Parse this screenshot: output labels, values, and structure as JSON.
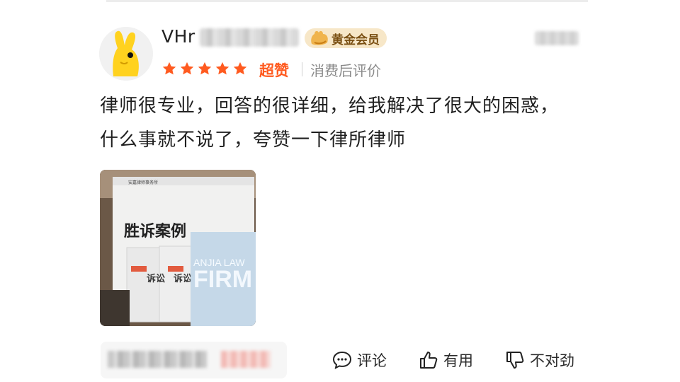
{
  "review": {
    "username": "VHr",
    "member_badge": "黄金会员",
    "rating_stars": 5,
    "rating_label": "超赞",
    "rating_note": "消费后评价",
    "content": "律师很专业，回答的很详细，给我解决了很大的困惑，什么事就不说了，夸赞一下律所律师",
    "photo": {
      "headline": "胜诉案例",
      "badge_text": "ANJIA LAW",
      "badge_text_2": "FIRM",
      "book_label": "诉讼"
    }
  },
  "actions": {
    "comment_label": "评论",
    "useful_label": "有用",
    "bad_label": "不对劲"
  },
  "colors": {
    "star": "#ff5a1f",
    "badge_bg": "#f7e7c8",
    "badge_text": "#7a4f12"
  },
  "icons": {
    "avatar": "rabbit-glove-avatar",
    "member": "gold-vip-icon",
    "comment": "comment-bubble-icon",
    "useful": "thumbs-up-icon",
    "bad": "thumbs-down-icon"
  }
}
